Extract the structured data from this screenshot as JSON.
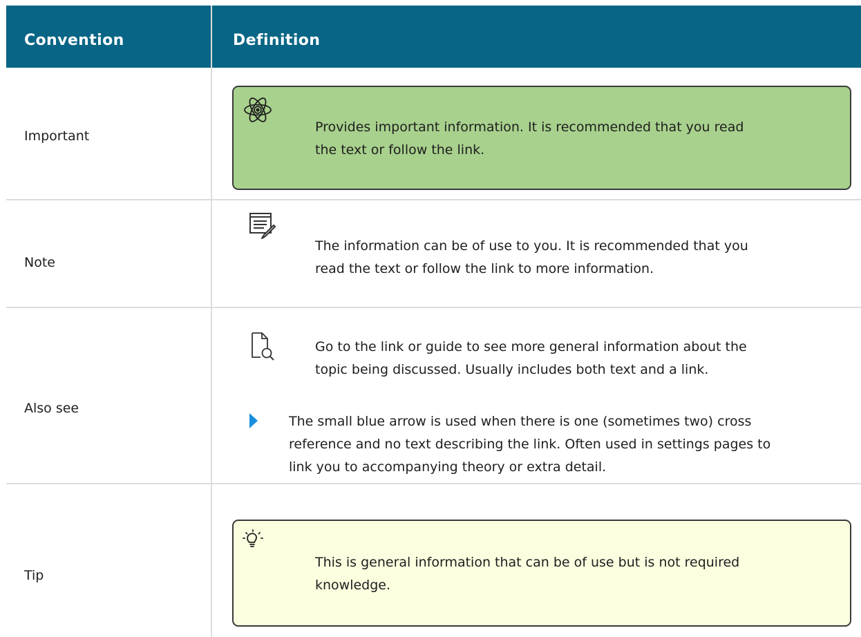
{
  "header": {
    "convention": "Convention",
    "definition": "Definition"
  },
  "rows": [
    {
      "convention": "Important",
      "icon": "atom-icon",
      "style": "green-callout",
      "definition": [
        "Provides important information. It is recommended that you read",
        "the text or follow the link."
      ]
    },
    {
      "convention": "Note",
      "icon": "note-pencil-icon",
      "definition": [
        "The information can be of use to you. It is recommended that you",
        "read the text or follow the link to more information."
      ]
    },
    {
      "convention": "Also see",
      "icon": "document-search-icon",
      "definition": [
        "Go to the link or guide to see more general information about the",
        "topic being discussed. Usually includes both text and a link."
      ],
      "arrow_icon": "blue-arrow-icon",
      "arrow_definition": [
        "The small blue arrow is used when there is one (sometimes two) cross",
        "reference and no text describing the link. Often used in settings pages to",
        "link you to accompanying theory or extra detail."
      ]
    },
    {
      "convention": "Tip",
      "icon": "lightbulb-icon",
      "style": "yellow-callout",
      "definition": [
        "This is general information that can be of use but is not required",
        "knowledge."
      ]
    }
  ],
  "colors": {
    "header_bg": "#086585",
    "important_bg": "#a8d18d",
    "tip_bg": "#fdfddf",
    "arrow": "#1a8fe0"
  }
}
